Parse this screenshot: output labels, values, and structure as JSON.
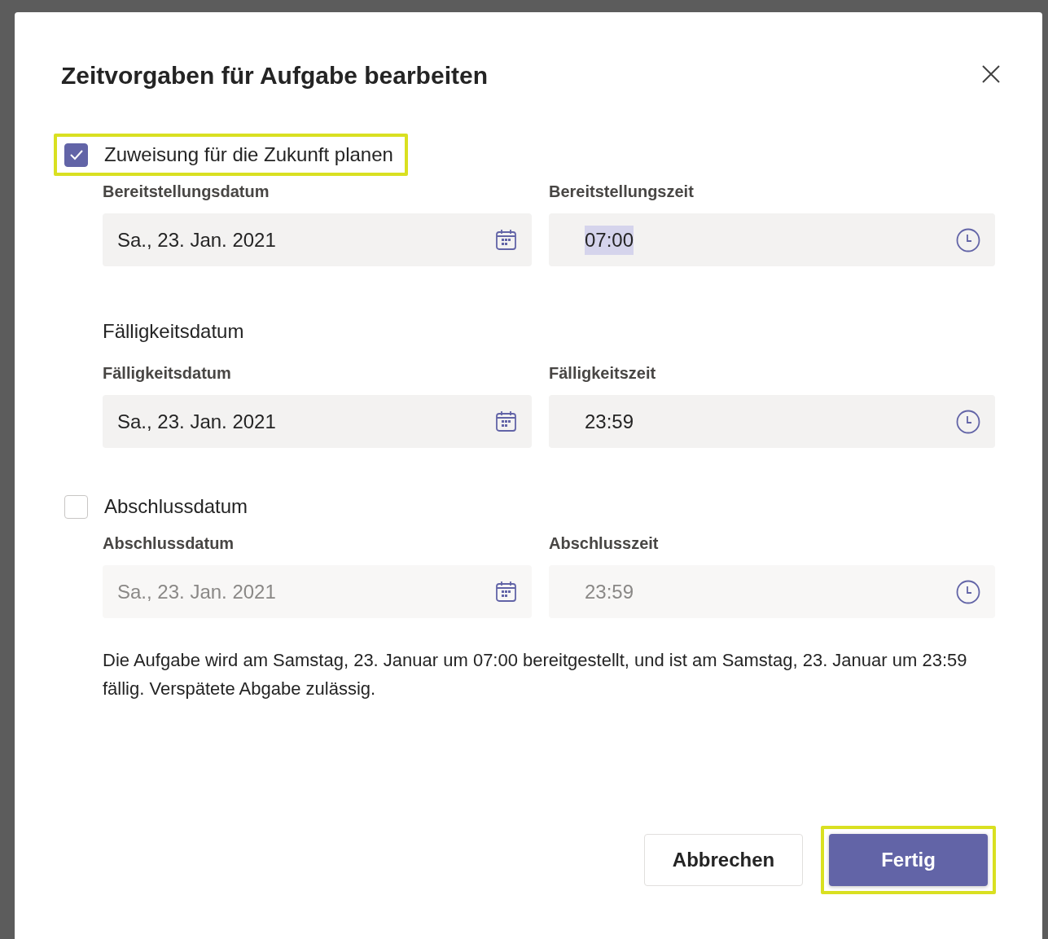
{
  "dialog": {
    "title": "Zeitvorgaben für Aufgabe bearbeiten",
    "sections": [
      {
        "checkbox": {
          "label": "Zuweisung für die Zukunft planen",
          "checked": true,
          "highlighted": true
        },
        "fields": [
          {
            "label": "Bereitstellungsdatum",
            "value": "Sa., 23. Jan. 2021",
            "kind": "date",
            "disabled": false,
            "text_selected": false
          },
          {
            "label": "Bereitstellungszeit",
            "value": "07:00",
            "kind": "time",
            "disabled": false,
            "text_selected": true
          }
        ]
      },
      {
        "heading": "Fälligkeitsdatum",
        "fields": [
          {
            "label": "Fälligkeitsdatum",
            "value": "Sa., 23. Jan. 2021",
            "kind": "date",
            "disabled": false,
            "text_selected": false
          },
          {
            "label": "Fälligkeitszeit",
            "value": "23:59",
            "kind": "time",
            "disabled": false,
            "text_selected": false
          }
        ]
      },
      {
        "checkbox": {
          "label": "Abschlussdatum",
          "checked": false,
          "highlighted": false
        },
        "fields": [
          {
            "label": "Abschlussdatum",
            "value": "Sa., 23. Jan. 2021",
            "kind": "date",
            "disabled": true,
            "text_selected": false
          },
          {
            "label": "Abschlusszeit",
            "value": "23:59",
            "kind": "time",
            "disabled": true,
            "text_selected": false
          }
        ]
      }
    ],
    "summary": "Die Aufgabe wird am Samstag, 23. Januar um 07:00 bereitgestellt, und ist am Samstag, 23. Januar um 23:59 fällig. Verspätete Abgabe zulässig.",
    "buttons": [
      {
        "label": "Abbrechen",
        "kind": "secondary",
        "highlighted": false
      },
      {
        "label": "Fertig",
        "kind": "primary",
        "highlighted": true
      }
    ]
  }
}
